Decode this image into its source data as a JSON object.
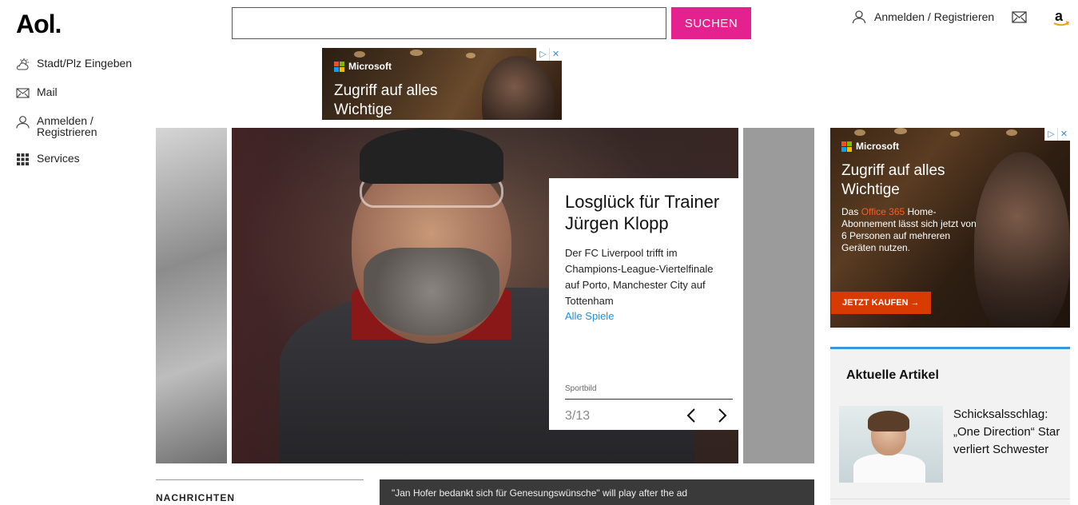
{
  "header": {
    "logo": "Aol.",
    "search": {
      "value": "",
      "placeholder": "",
      "button_label": "SUCHEN"
    },
    "login_label": "Anmelden / Registrieren",
    "accent_color": "#e4218f"
  },
  "leftnav": {
    "items": [
      {
        "label": "Stadt/Plz Eingeben",
        "icon": "weather-icon"
      },
      {
        "label": "Mail",
        "icon": "mail-icon"
      },
      {
        "label": "Anmelden / Registrieren",
        "icon": "user-icon"
      },
      {
        "label": "Services",
        "icon": "grid-icon"
      }
    ]
  },
  "top_ad": {
    "brand": "Microsoft",
    "headline": "Zugriff auf alles Wichtige"
  },
  "side_ad": {
    "brand": "Microsoft",
    "headline": "Zugriff auf alles Wichtige",
    "body_pre": "Das ",
    "body_highlight": "Office 365",
    "body_post": " Home-Abonnement lässt sich jetzt von 6 Personen auf mehreren Geräten nutzen.",
    "cta": "JETZT KAUFEN →"
  },
  "carousel": {
    "title": "Losglück für Trainer Jürgen Klopp",
    "text": "Der FC Liverpool trifft im Champions-League-Viertelfinale auf Porto, Manchester City auf Tottenham",
    "link": "Alle Spiele",
    "source": "Sportbild",
    "counter": "3/13",
    "prev": "‹",
    "next": "›"
  },
  "news": {
    "label": "NACHRICHTEN",
    "video_text": "\"Jan Hofer bedankt sich für Genesungswünsche\" will play after the ad"
  },
  "aktuelle_artikel": {
    "title": "Aktuelle Artikel",
    "items": [
      {
        "text": "Schicksalsschlag: „One Direction“ Star verliert Schwester"
      }
    ]
  }
}
